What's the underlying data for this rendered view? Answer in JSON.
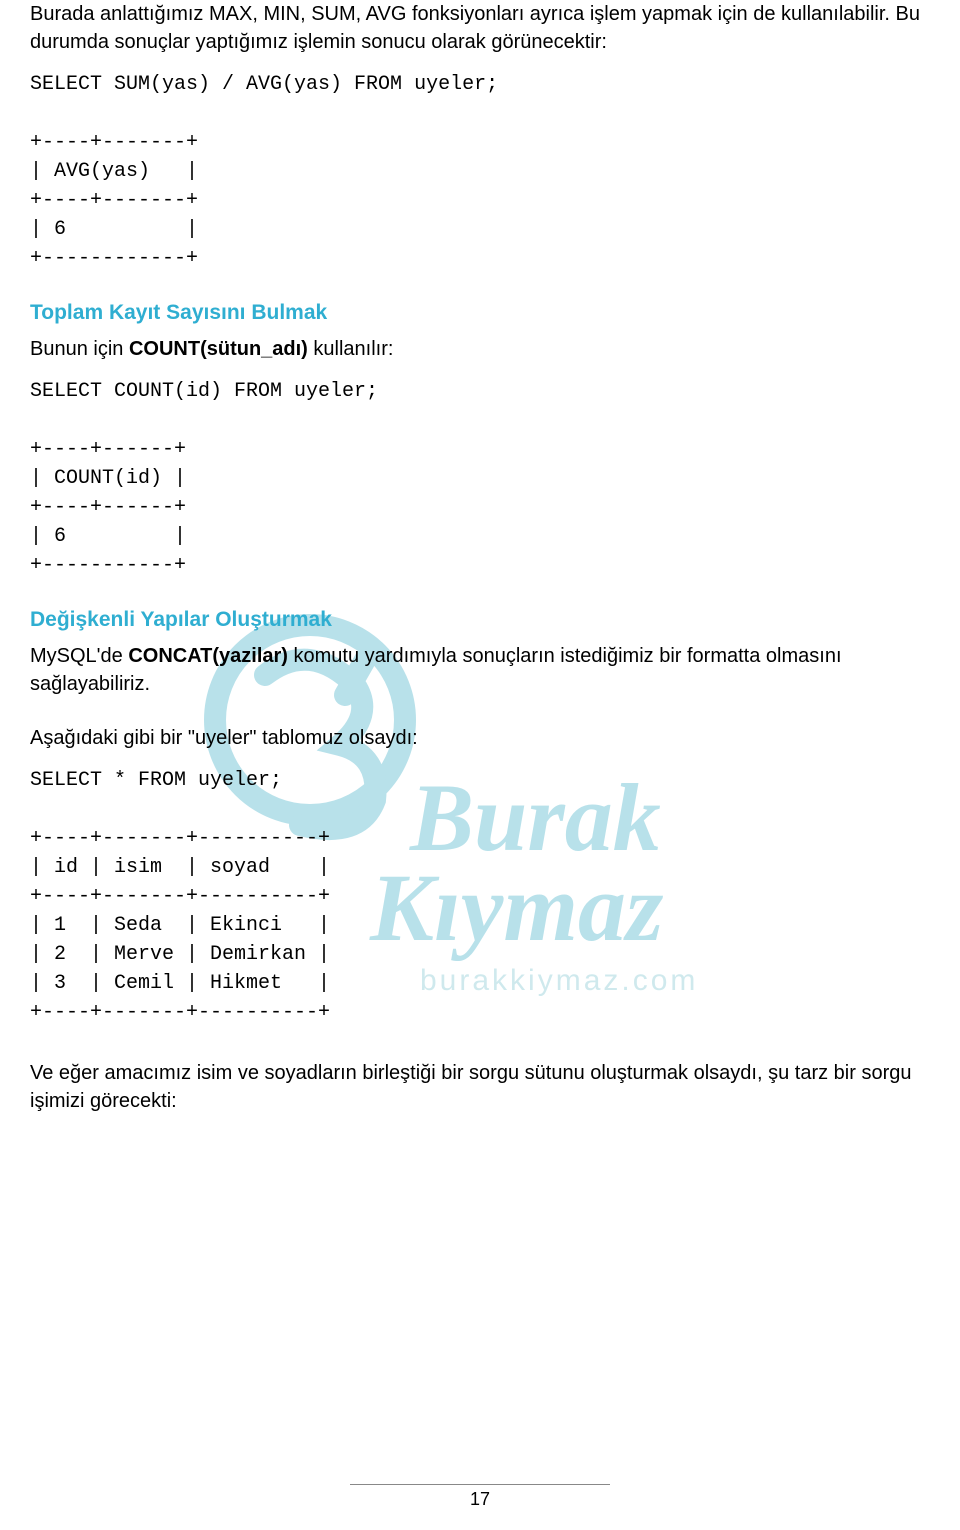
{
  "intro_paragraph": "Burada anlattığımız MAX, MIN, SUM, AVG fonksiyonları ayrıca işlem yapmak için de kullanılabilir. Bu durumda sonuçlar yaptığımız işlemin sonucu olarak görünecektir:",
  "code1": "SELECT SUM(yas) / AVG(yas) FROM uyeler;\n\n+----+-------+\n| AVG(yas)   |\n+----+-------+\n| 6          |\n+------------+",
  "heading2": "Toplam Kayıt Sayısını Bulmak",
  "para2_prefix": "Bunun için ",
  "para2_bold": "COUNT(sütun_adı)",
  "para2_suffix": " kullanılır:",
  "code2": "SELECT COUNT(id) FROM uyeler;\n\n+----+------+\n| COUNT(id) |\n+----+------+\n| 6         |\n+-----------+",
  "heading3": "Değişkenli Yapılar Oluşturmak",
  "para3_prefix": "MySQL'de ",
  "para3_bold": "CONCAT(yazilar)",
  "para3_suffix": " komutu yardımıyla sonuçların istediğimiz bir formatta olmasını sağlayabiliriz.",
  "para4": "Aşağıdaki gibi bir \"uyeler\" tablomuz olsaydı:",
  "code3": "SELECT * FROM uyeler;\n\n+----+-------+----------+\n| id | isim  | soyad    |\n+----+-------+----------+\n| 1  | Seda  | Ekinci   |\n| 2  | Merve | Demirkan |\n| 3  | Cemil | Hikmet   |\n+----+-------+----------+",
  "para5": "Ve eğer amacımız isim ve soyadların birleştiği bir sorgu sütunu oluşturmak olsaydı, şu tarz bir sorgu işimizi görecekti:",
  "page_number": "17",
  "watermark_name": "Burak Kıymaz",
  "watermark_url": "burakkiymaz.com"
}
